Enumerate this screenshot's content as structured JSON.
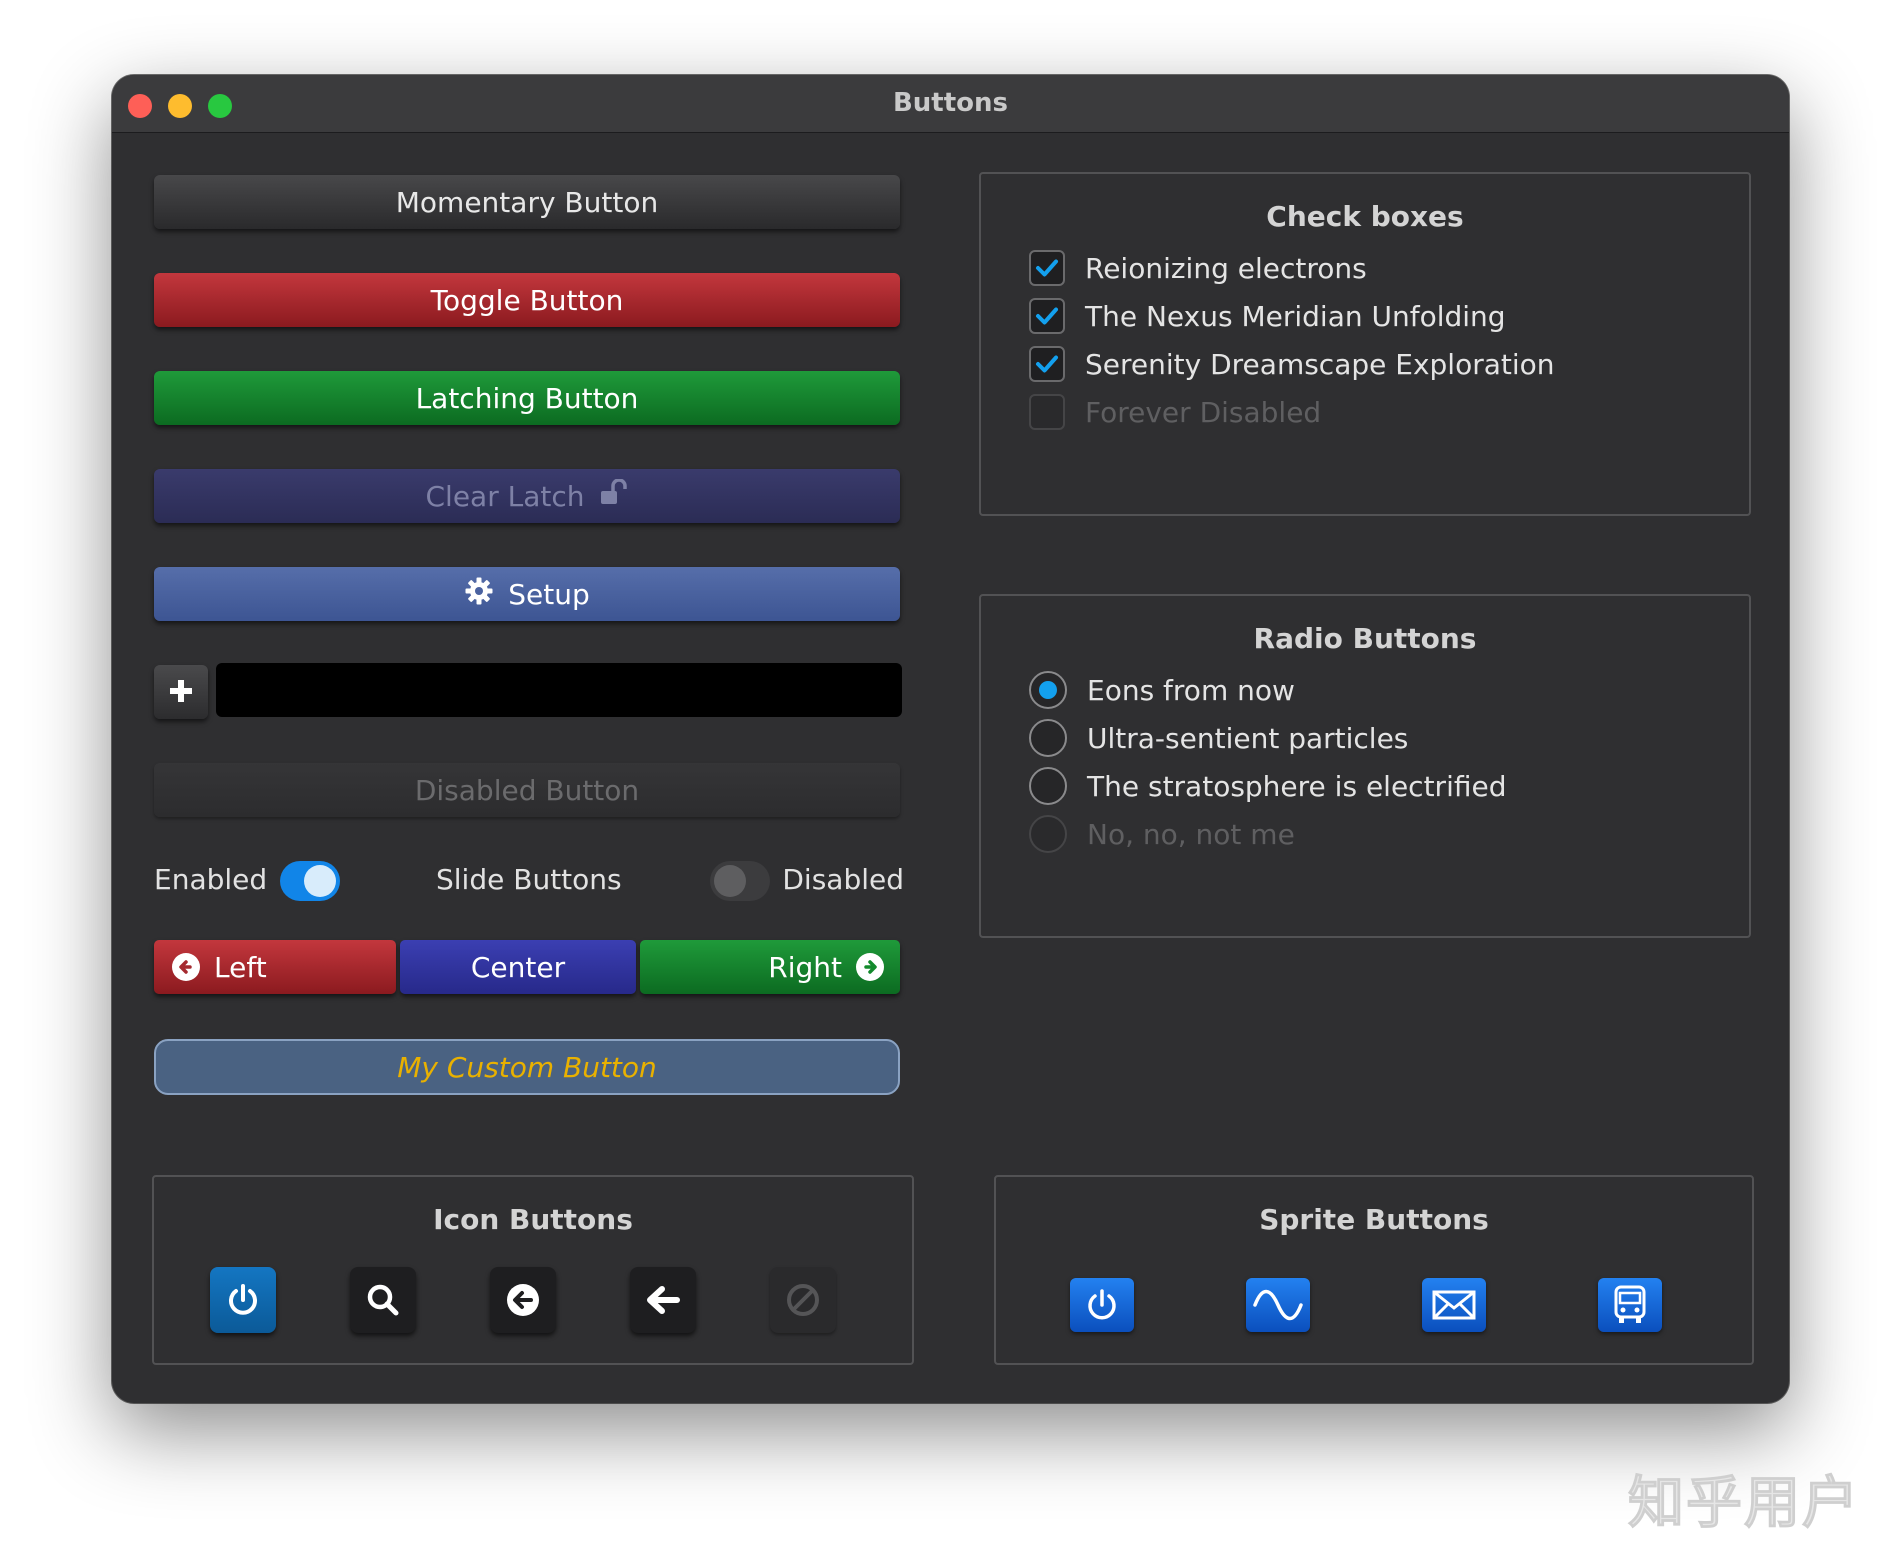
{
  "window": {
    "title": "Buttons"
  },
  "buttons": {
    "momentary": "Momentary Button",
    "toggle": "Toggle Button",
    "latching": "Latching Button",
    "clear_latch": "Clear Latch",
    "setup": "Setup",
    "disabled": "Disabled Button",
    "custom": "My Custom Button"
  },
  "text_field": {
    "value": ""
  },
  "slide_buttons": {
    "enabled_label": "Enabled",
    "title": "Slide Buttons",
    "disabled_label": "Disabled",
    "enabled_state": true,
    "disabled_state": false
  },
  "segmented": {
    "left": "Left",
    "center": "Center",
    "right": "Right"
  },
  "check_boxes": {
    "title": "Check boxes",
    "items": [
      {
        "label": "Reionizing electrons",
        "checked": true,
        "enabled": true
      },
      {
        "label": "The Nexus Meridian Unfolding",
        "checked": true,
        "enabled": true
      },
      {
        "label": "Serenity Dreamscape Exploration",
        "checked": true,
        "enabled": true
      },
      {
        "label": "Forever Disabled",
        "checked": false,
        "enabled": false
      }
    ]
  },
  "radio_buttons": {
    "title": "Radio Buttons",
    "items": [
      {
        "label": "Eons from now",
        "selected": true,
        "enabled": true
      },
      {
        "label": "Ultra-sentient particles",
        "selected": false,
        "enabled": true
      },
      {
        "label": "The stratosphere is electrified",
        "selected": false,
        "enabled": true
      },
      {
        "label": "No, no, not me",
        "selected": false,
        "enabled": false
      }
    ]
  },
  "icon_buttons": {
    "title": "Icon Buttons",
    "icons": [
      "power-icon",
      "search-icon",
      "arrow-circle-left-icon",
      "arrow-left-icon",
      "ban-icon"
    ]
  },
  "sprite_buttons": {
    "title": "Sprite Buttons",
    "icons": [
      "power-icon",
      "sine-wave-icon",
      "envelope-icon",
      "bus-icon"
    ]
  },
  "watermark": "知乎用户",
  "colors": {
    "window_bg": "#2f2f31",
    "toggle_red": "#a52a30",
    "latching_green": "#138a2c",
    "setup_blue": "#4a62a0",
    "accent_blue": "#13a0ee",
    "custom_text": "#e9b100"
  }
}
